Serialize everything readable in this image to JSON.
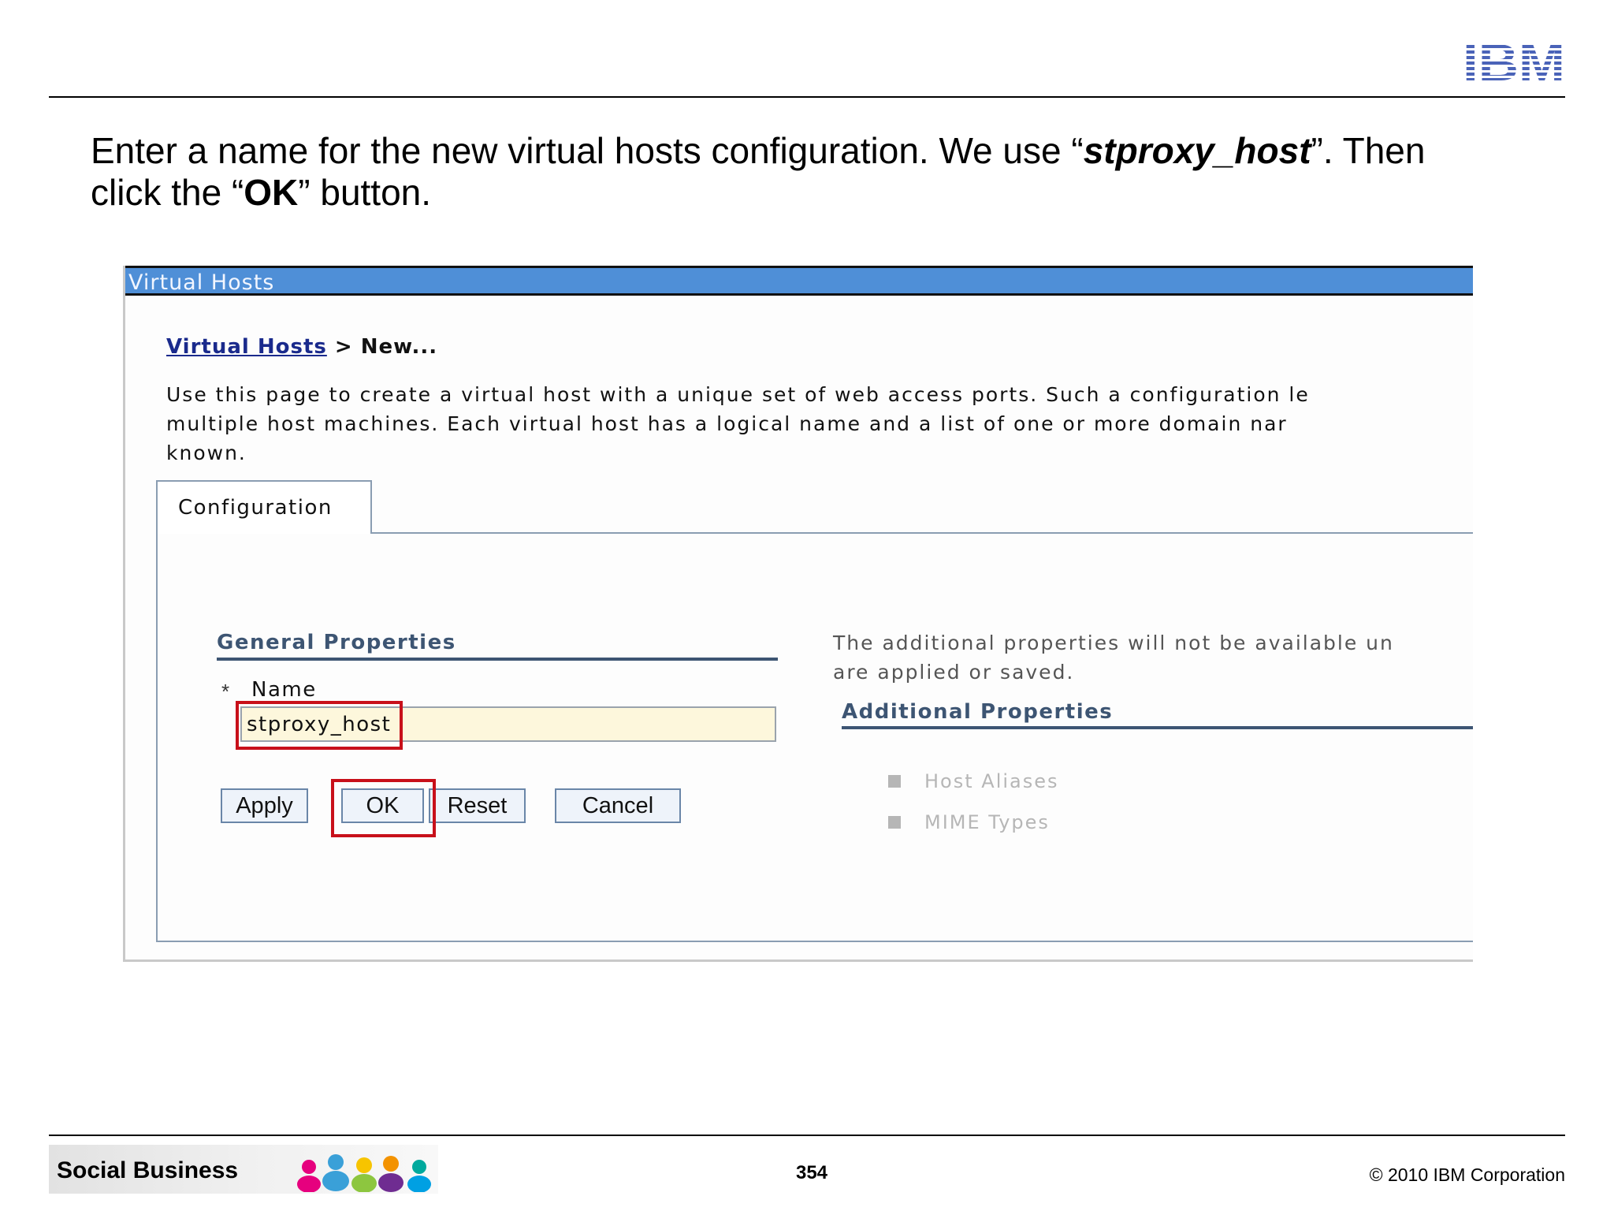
{
  "slide": {
    "logo_text": "IBM",
    "instruction": {
      "part1": "Enter a name for the new virtual hosts configuration. We use “",
      "emphasis_name": "stproxy_host",
      "part2": "”. Then",
      "part3": "click the “",
      "emphasis_button": "OK",
      "part4": "” button."
    },
    "footer": {
      "brand": "Social Business",
      "page_number": "354",
      "copyright": "© 2010 IBM Corporation"
    }
  },
  "console": {
    "title": "Virtual Hosts",
    "breadcrumb": {
      "link": "Virtual Hosts",
      "separator": ">",
      "current": "New..."
    },
    "description_lines": [
      "Use this page to create a virtual host with a unique set of web access ports. Such a configuration le",
      "multiple host machines. Each virtual host has a logical name and a list of one or more domain nar",
      "known."
    ],
    "tab_label": "Configuration",
    "general_properties": {
      "heading": "General Properties",
      "required_marker": "*",
      "name_label": "Name",
      "name_value": "stproxy_host"
    },
    "buttons": {
      "apply": "Apply",
      "ok": "OK",
      "reset": "Reset",
      "cancel": "Cancel"
    },
    "additional_properties": {
      "note_lines": [
        "The additional properties will not be available un",
        "are applied or saved."
      ],
      "heading": "Additional Properties",
      "items": [
        "Host Aliases",
        "MIME Types"
      ]
    },
    "highlight_color": "#c8101a",
    "titlebar_color": "#4f8fd7"
  }
}
